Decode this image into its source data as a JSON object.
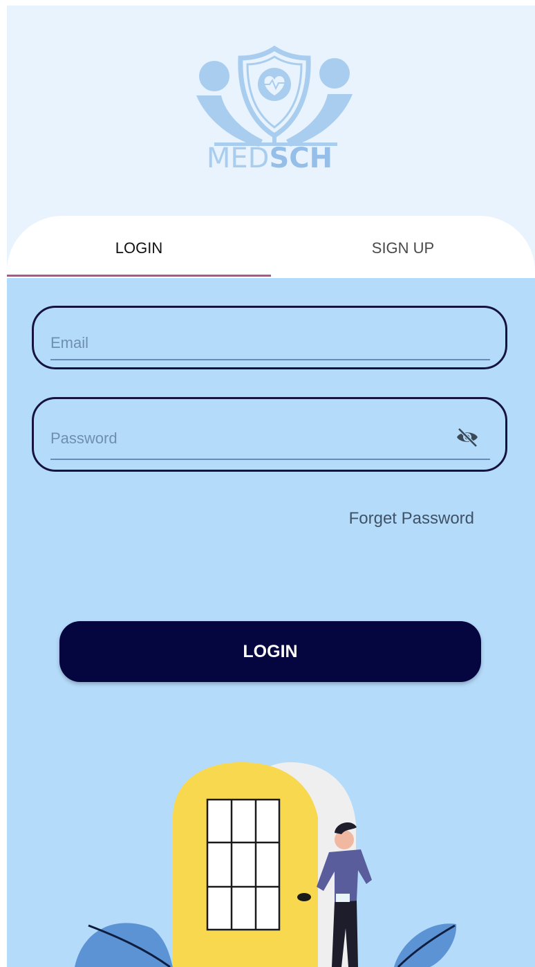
{
  "app": {
    "logo_text_light": "MED",
    "logo_text_bold": "SCH"
  },
  "tabs": {
    "login_label": "LOGIN",
    "signup_label": "SIGN UP",
    "active": "login"
  },
  "form": {
    "email_placeholder": "Email",
    "email_value": "",
    "password_placeholder": "Password",
    "password_value": "",
    "password_visibility_icon": "eye-off-icon",
    "forget_password_label": "Forget Password",
    "login_button_label": "LOGIN"
  },
  "colors": {
    "header_bg": "#e8f3fd",
    "form_bg": "#b5dbfb",
    "button_bg": "#05063f",
    "tab_indicator": "#b0558a",
    "field_border": "#151340"
  }
}
